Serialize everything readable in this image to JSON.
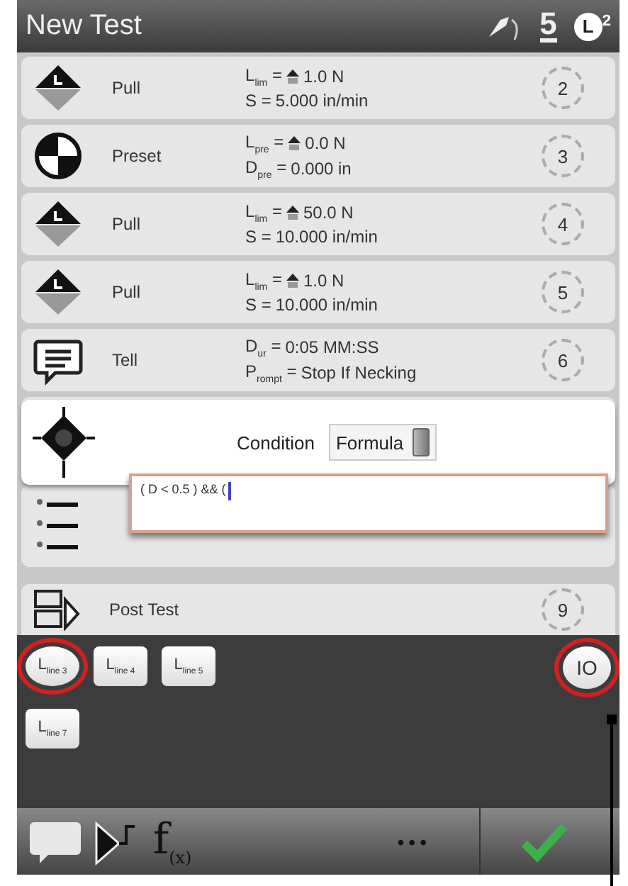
{
  "window": {
    "title": "New Test",
    "status_number": "5",
    "level_letter": "L",
    "level_superscript": "2"
  },
  "steps": [
    {
      "kind": "pull",
      "name": "Pull",
      "number": "2",
      "params": [
        {
          "label": "L$_{lim}$ =",
          "direction_icon": true,
          "value": "1.0 N"
        },
        {
          "label": "S =",
          "direction_icon": false,
          "value": "5.000 in/min"
        }
      ]
    },
    {
      "kind": "preset",
      "name": "Preset",
      "number": "3",
      "params": [
        {
          "label": "L$_{pre}$ =",
          "direction_icon": true,
          "value": "0.0 N"
        },
        {
          "label": "D$_{pre}$ =",
          "direction_icon": false,
          "value": "0.000 in"
        }
      ]
    },
    {
      "kind": "pull",
      "name": "Pull",
      "number": "4",
      "params": [
        {
          "label": "L$_{lim}$ =",
          "direction_icon": true,
          "value": "50.0 N"
        },
        {
          "label": "S =",
          "direction_icon": false,
          "value": "10.000 in/min"
        }
      ]
    },
    {
      "kind": "pull",
      "name": "Pull",
      "number": "5",
      "params": [
        {
          "label": "L$_{lim}$ =",
          "direction_icon": true,
          "value": "1.0 N"
        },
        {
          "label": "S =",
          "direction_icon": false,
          "value": "10.000 in/min"
        }
      ]
    },
    {
      "kind": "tell",
      "name": "Tell",
      "number": "6",
      "params": [
        {
          "label": "D$_{ur}$ =",
          "direction_icon": false,
          "value": "0:05 MM:SS"
        },
        {
          "label": "P$_{rompt}$ =",
          "direction_icon": false,
          "value": "Stop If Necking"
        }
      ]
    }
  ],
  "condition_editor": {
    "label": "Condition",
    "mode": "Formula",
    "formula": "( D < 0.5 ) && ("
  },
  "post_test": {
    "name": "Post Test",
    "number": "9"
  },
  "tokens": [
    {
      "label": "L$_{line 3}$",
      "highlighted": true
    },
    {
      "label": "L$_{line 4}$",
      "highlighted": false
    },
    {
      "label": "L$_{line 5}$",
      "highlighted": false
    },
    {
      "label": "L$_{line 7}$",
      "highlighted": false
    }
  ],
  "io_button": {
    "label": "IO",
    "highlighted": true
  },
  "toolbar": {
    "function_label": "f$_{(x)}$",
    "more_label": "•••"
  }
}
